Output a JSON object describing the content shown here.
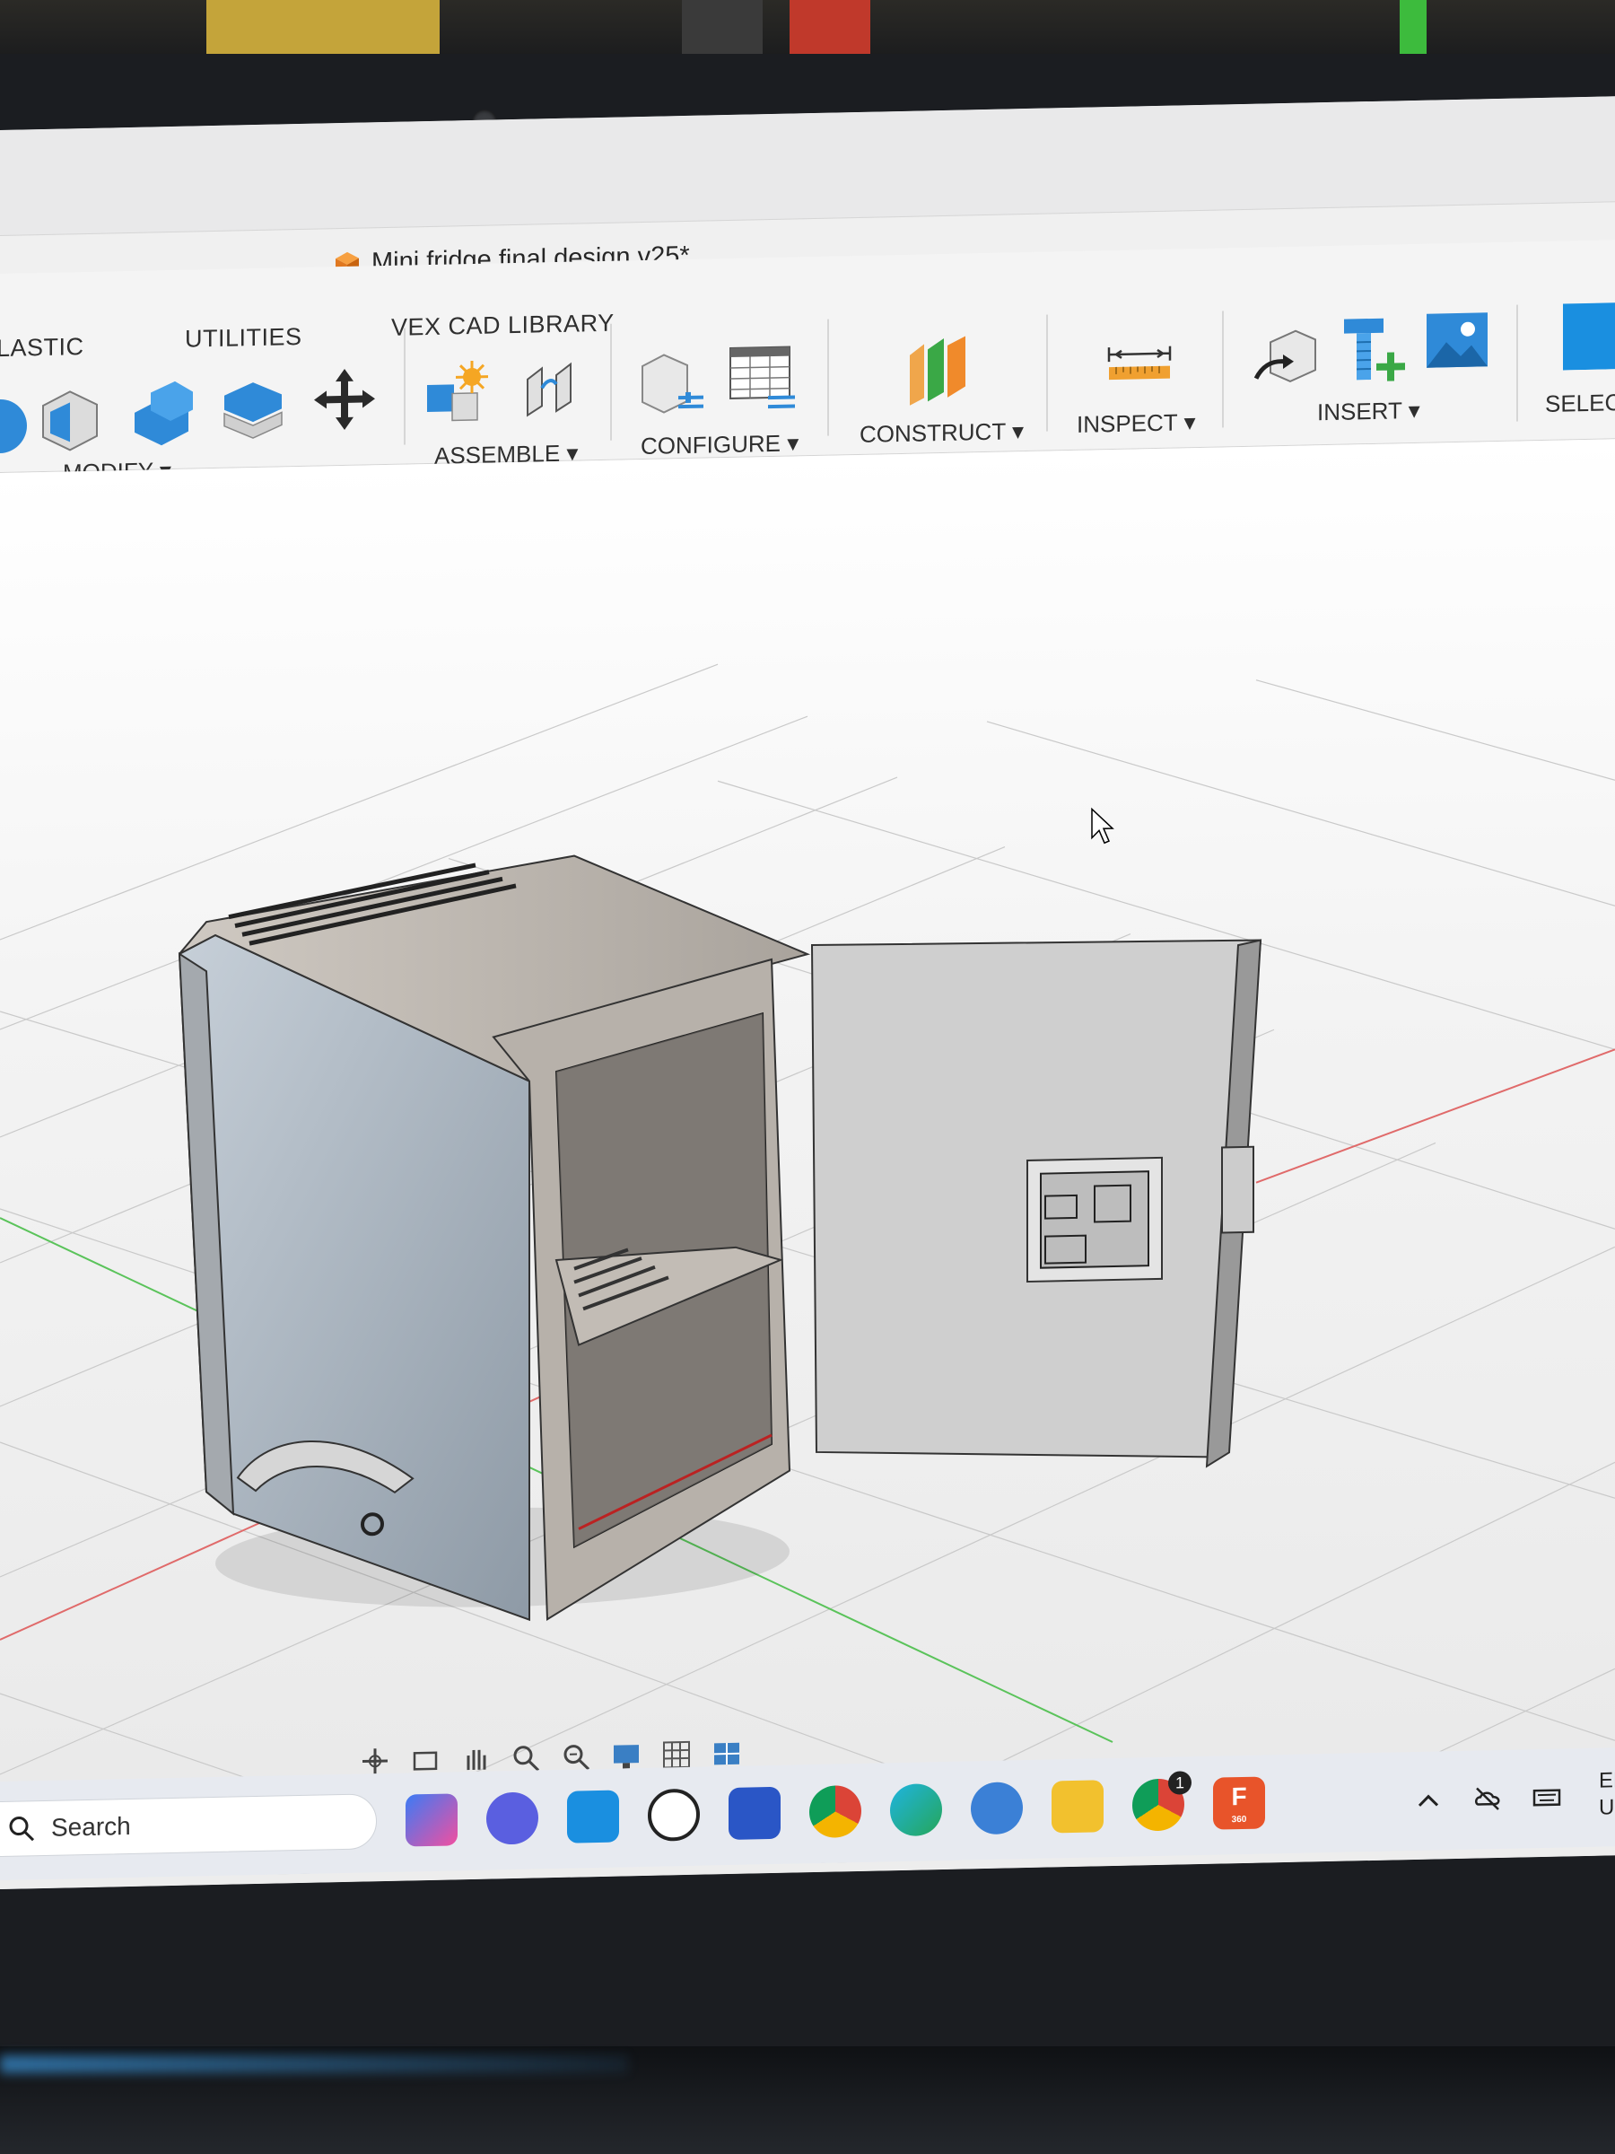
{
  "document": {
    "title": "Mini fridge final design v25*",
    "icon": "orange-cube-icon"
  },
  "tabs": [
    {
      "label": "LASTIC"
    },
    {
      "label": "UTILITIES"
    },
    {
      "label": "VEX CAD LIBRARY"
    }
  ],
  "groups": {
    "modify": "MODIFY ▾",
    "assemble": "ASSEMBLE ▾",
    "configure": "CONFIGURE ▾",
    "construct": "CONSTRUCT ▾",
    "inspect": "INSPECT ▾",
    "insert": "INSERT ▾",
    "select": "SELEC"
  },
  "colors": {
    "accent_blue": "#1a8fe0",
    "fusion_orange": "#f26522",
    "construct_green": "#3aa846"
  },
  "taskbar": {
    "search_label": "Search",
    "language": "EN",
    "language_sub": "U",
    "badge_count": "1",
    "fusion_label": "F",
    "fusion_sub": "360"
  }
}
